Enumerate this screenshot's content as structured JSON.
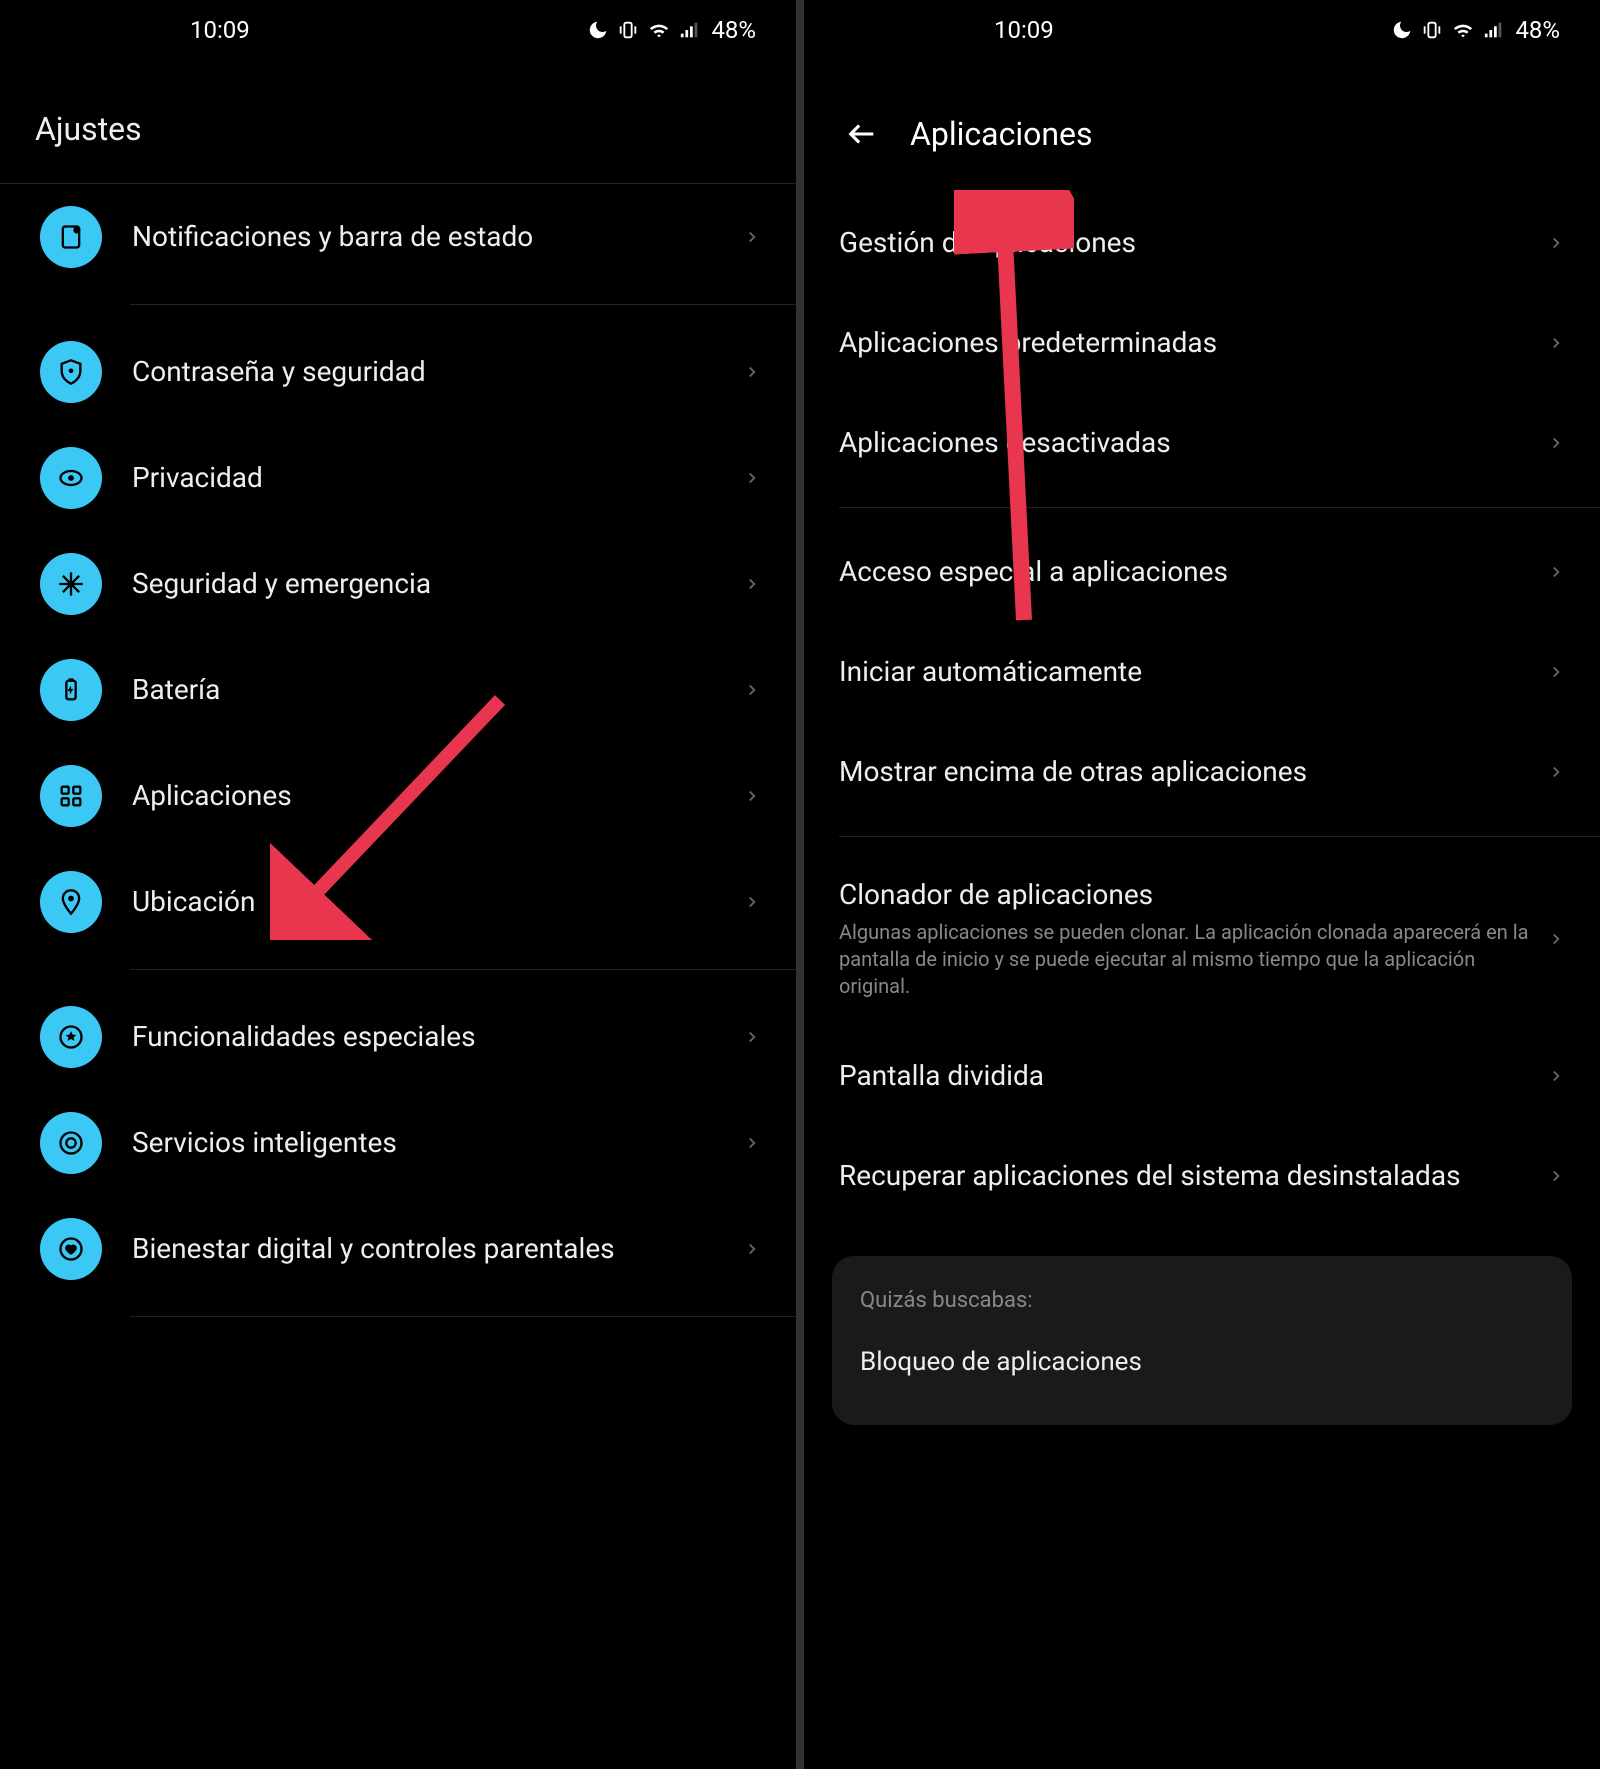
{
  "status": {
    "time": "10:09",
    "battery": "48%"
  },
  "left": {
    "title": "Ajustes",
    "items": [
      {
        "icon": "notification",
        "label": "Notificaciones y barra de estado"
      },
      {
        "icon": "shield",
        "label": "Contraseña y seguridad"
      },
      {
        "icon": "eye",
        "label": "Privacidad"
      },
      {
        "icon": "medical",
        "label": "Seguridad y emergencia"
      },
      {
        "icon": "battery",
        "label": "Batería"
      },
      {
        "icon": "apps",
        "label": "Aplicaciones"
      },
      {
        "icon": "location",
        "label": "Ubicación"
      },
      {
        "icon": "star",
        "label": "Funcionalidades especiales"
      },
      {
        "icon": "circle",
        "label": "Servicios inteligentes"
      },
      {
        "icon": "heart",
        "label": "Bienestar digital y controles parentales"
      }
    ]
  },
  "right": {
    "title": "Aplicaciones",
    "groups": [
      [
        {
          "label": "Gestión de aplicaciones"
        },
        {
          "label": "Aplicaciones predeterminadas"
        },
        {
          "label": "Aplicaciones desactivadas"
        }
      ],
      [
        {
          "label": "Acceso especial a aplicaciones"
        },
        {
          "label": "Iniciar automáticamente"
        },
        {
          "label": "Mostrar encima de otras aplicaciones"
        }
      ],
      [
        {
          "label": "Clonador de aplicaciones",
          "sub": "Algunas aplicaciones se pueden clonar. La aplicación clonada aparecerá en la pantalla de inicio y se puede ejecutar al mismo tiempo que la aplicación original."
        },
        {
          "label": "Pantalla dividida"
        },
        {
          "label": "Recuperar aplicaciones del sistema desinstaladas"
        }
      ]
    ],
    "suggest_title": "Quizás buscabas:",
    "suggest_item": "Bloqueo de aplicaciones"
  }
}
